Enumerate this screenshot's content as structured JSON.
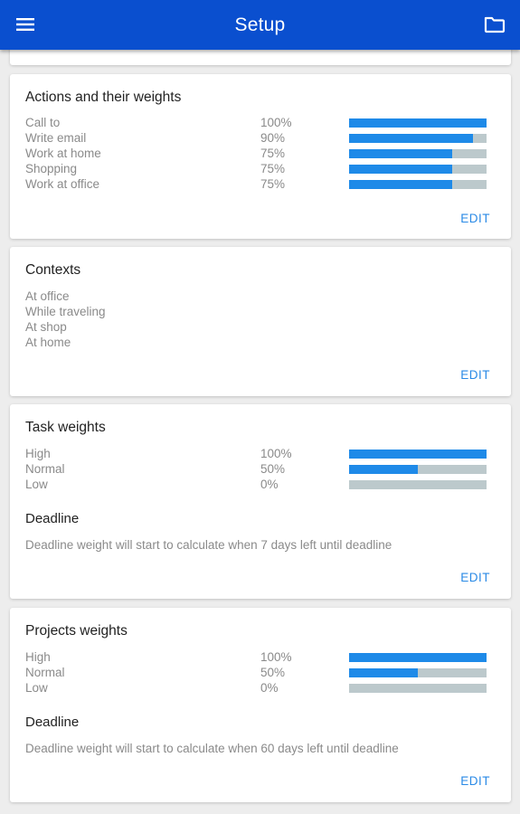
{
  "appbar": {
    "title": "Setup",
    "menu_icon": "hamburger-menu-icon",
    "folder_icon": "folder-icon",
    "color": "#0a4fcf"
  },
  "accent_color": "#1e8ae8",
  "actions_card": {
    "title": "Actions and their weights",
    "items": [
      {
        "label": "Call to",
        "percent": "100%",
        "value": 1.0
      },
      {
        "label": "Write email",
        "percent": "90%",
        "value": 0.9
      },
      {
        "label": "Work at home",
        "percent": "75%",
        "value": 0.75
      },
      {
        "label": "Shopping",
        "percent": "75%",
        "value": 0.75
      },
      {
        "label": "Work at office",
        "percent": "75%",
        "value": 0.75
      }
    ],
    "edit_label": "EDIT"
  },
  "contexts_card": {
    "title": "Contexts",
    "items": [
      "At office",
      "While traveling",
      "At shop",
      "At home"
    ],
    "edit_label": "EDIT"
  },
  "task_card": {
    "title": "Task weights",
    "items": [
      {
        "label": "High",
        "percent": "100%",
        "value": 1.0
      },
      {
        "label": "Normal",
        "percent": "50%",
        "value": 0.5
      },
      {
        "label": "Low",
        "percent": "0%",
        "value": 0.0
      }
    ],
    "deadline_title": "Deadline",
    "deadline_text": "Deadline weight will start to calculate when 7 days left until deadline",
    "edit_label": "EDIT"
  },
  "projects_card": {
    "title": "Projects weights",
    "items": [
      {
        "label": "High",
        "percent": "100%",
        "value": 1.0
      },
      {
        "label": "Normal",
        "percent": "50%",
        "value": 0.5
      },
      {
        "label": "Low",
        "percent": "0%",
        "value": 0.0
      }
    ],
    "deadline_title": "Deadline",
    "deadline_text": "Deadline weight will start to calculate when 60 days left until deadline",
    "edit_label": "EDIT"
  }
}
